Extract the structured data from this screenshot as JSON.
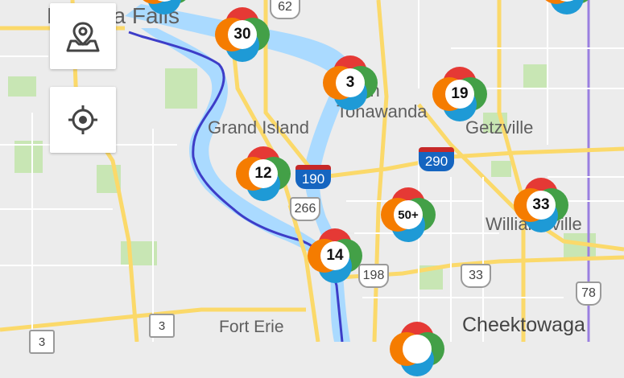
{
  "places": {
    "niagara_falls": "Niagara Falls",
    "grand_island": "Grand Island",
    "north_tonawanda": "North\nTonawanda",
    "getzville": "Getzville",
    "williamsville": "Williamsville",
    "fort_erie": "Fort Erie",
    "cheektowaga": "Cheektowaga"
  },
  "clusters": {
    "c1": "30",
    "c2": "3",
    "c3": "19",
    "c4": "12",
    "c5": "50+",
    "c6": "33",
    "c7": "14"
  },
  "routes": {
    "r62": "62",
    "r190": "190",
    "r290": "290",
    "r266": "266",
    "r198": "198",
    "r33": "33",
    "r78": "78",
    "r3": "3",
    "r3b": "3"
  },
  "controls": {
    "location_icon": "map-pin-icon",
    "gps_icon": "crosshair-icon"
  },
  "colors": {
    "water": "#aadaff",
    "land": "#ececec",
    "park": "#c8e6b4",
    "road": "#fbd96a",
    "border": "#3d3dc8",
    "boundary": "#9a7fe0"
  }
}
